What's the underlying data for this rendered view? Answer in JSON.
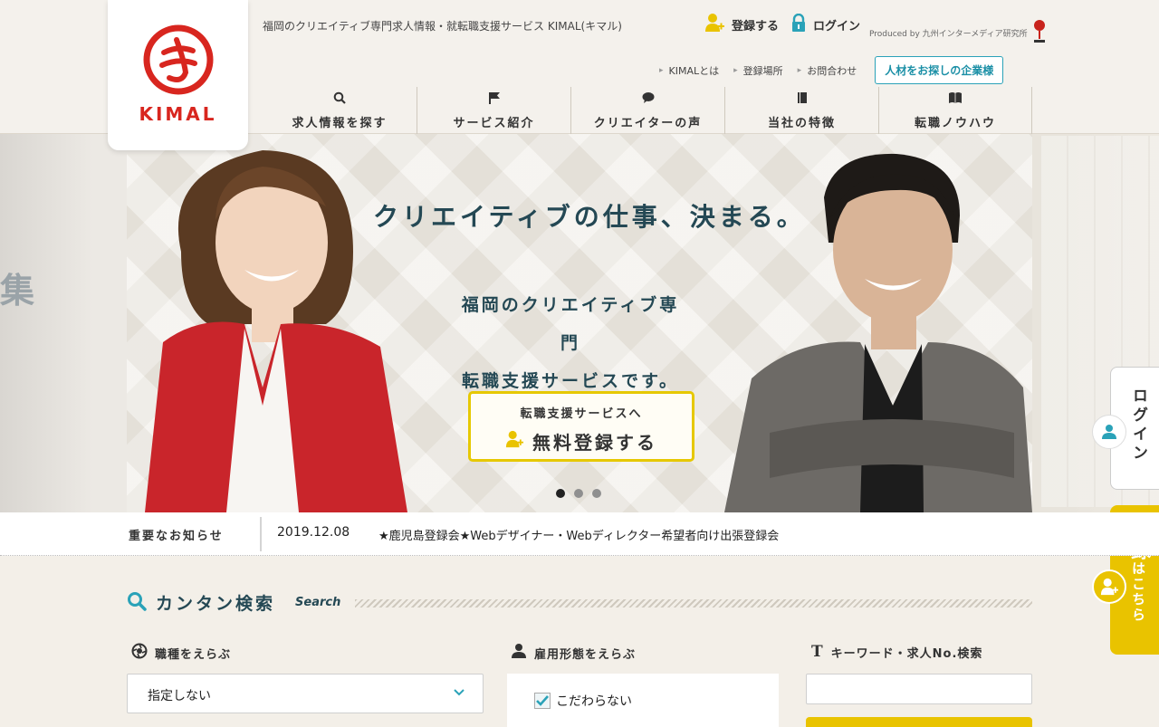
{
  "header": {
    "tagline": "福岡のクリエイティブ専門求人情報・就転職支援サービス KIMAL(キマル)",
    "logo_text": "KIMAL",
    "register_label": "登録する",
    "login_label": "ログイン",
    "produced_by": "Produced by 九州インターメディア研究所",
    "sub_links": [
      "KIMALとは",
      "登録場所",
      "お問合わせ"
    ],
    "corporate_button": "人材をお探しの企業様",
    "nav": [
      {
        "label": "求人情報を探す",
        "icon": "search-icon"
      },
      {
        "label": "サービス紹介",
        "icon": "flag-icon"
      },
      {
        "label": "クリエイターの声",
        "icon": "speech-bubble-icon"
      },
      {
        "label": "当社の特徴",
        "icon": "book-icon"
      },
      {
        "label": "転職ノウハウ",
        "icon": "open-book-icon"
      }
    ]
  },
  "hero": {
    "title": "クリエイティブの仕事、決まる。",
    "subtitle_line1": "福岡のクリエイティブ専門",
    "subtitle_line2": "転職支援サービスです。",
    "cta_top": "転職支援サービスへ",
    "cta_main": "無料登録する",
    "left_deco_char": "集",
    "slides": 3,
    "active_slide": 1
  },
  "side": {
    "login": "ログイン",
    "register_main": "登録",
    "register_sub": "はこちら"
  },
  "news": {
    "label": "重要なお知らせ",
    "date": "2019.12.08",
    "text": "★鹿児島登録会★Webデザイナー・Webディレクター希望者向け出張登録会"
  },
  "search": {
    "title": "カンタン検索",
    "title_en": "Search",
    "job_type_label": "職種をえらぶ",
    "job_type_value": "指定しない",
    "employment_label": "雇用形態をえらぶ",
    "employment_option": "こだわらない",
    "keyword_label": "キーワード・求人No.検索",
    "keyword_value": ""
  },
  "colors": {
    "brand_red": "#d8261f",
    "accent_yellow": "#e9c300",
    "accent_teal": "#2aa2b8",
    "navy_text": "#244854"
  }
}
